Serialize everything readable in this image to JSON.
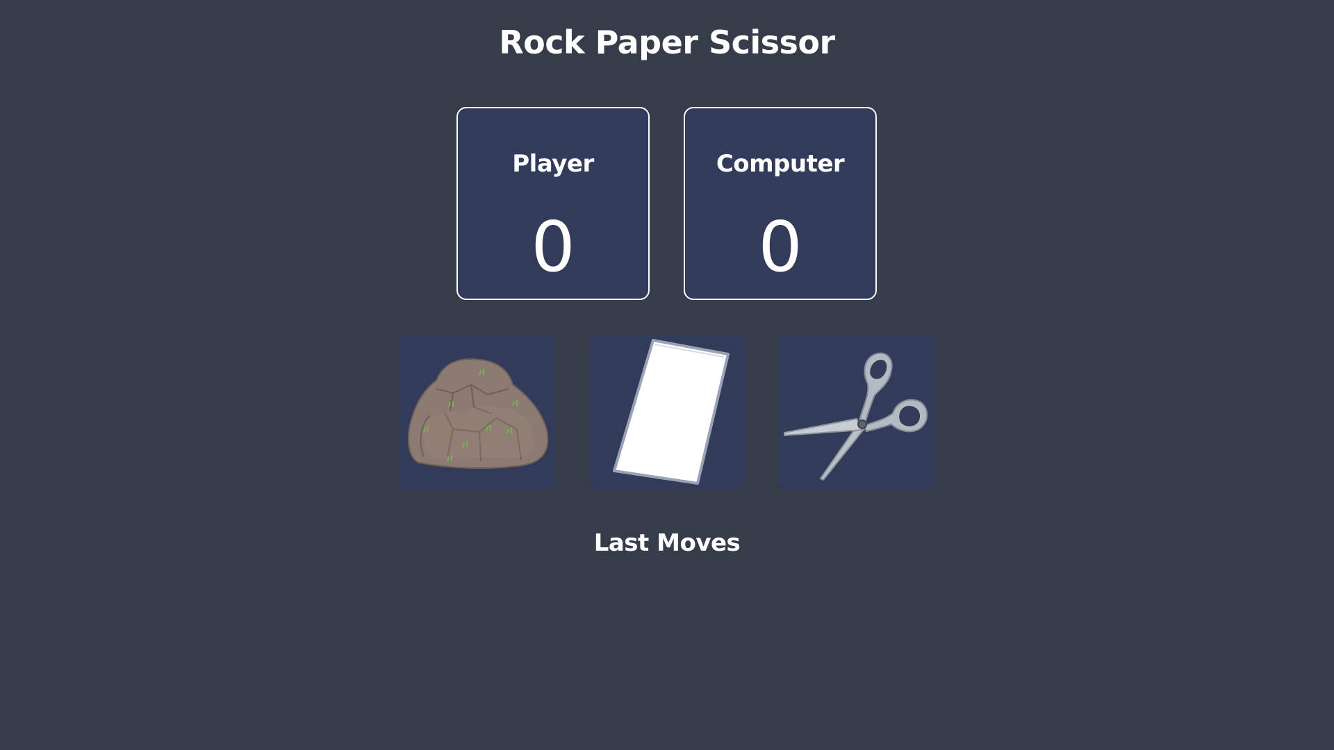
{
  "header": {
    "title": "Rock Paper Scissor"
  },
  "scoreboard": {
    "player": {
      "label": "Player",
      "score": "0"
    },
    "computer": {
      "label": "Computer",
      "score": "0"
    }
  },
  "choices": [
    {
      "name": "rock",
      "icon": "rock-icon"
    },
    {
      "name": "paper",
      "icon": "paper-icon"
    },
    {
      "name": "scissor",
      "icon": "scissors-icon"
    }
  ],
  "history": {
    "label": "Last Moves"
  },
  "colors": {
    "background": "#373c4b",
    "card": "#323b5a",
    "text": "#ffffff"
  }
}
